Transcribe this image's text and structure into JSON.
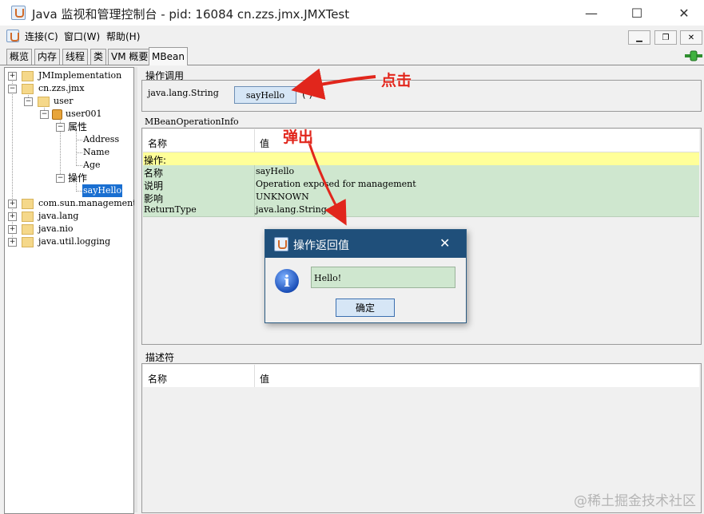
{
  "window": {
    "title": "Java 监视和管理控制台 - pid: 16084 cn.zzs.jmx.JMXTest",
    "minimize": "—",
    "maximize": "☐",
    "close": "✕"
  },
  "menu": [
    "连接(C)",
    "窗口(W)",
    "帮助(H)"
  ],
  "tabs": [
    "概览",
    "内存",
    "线程",
    "类",
    "VM 概要",
    "MBean"
  ],
  "tree": {
    "nodes": [
      "JMImplementation",
      "cn.zzs.jmx",
      "user",
      "user001",
      "属性",
      "Address",
      "Name",
      "Age",
      "操作",
      "sayHello",
      "com.sun.management",
      "java.lang",
      "java.nio",
      "java.util.logging"
    ]
  },
  "invoke": {
    "group_title": "操作调用",
    "return_type": "java.lang.String",
    "button_label": "sayHello",
    "parens": "( )"
  },
  "op_info": {
    "group_title": "MBeanOperationInfo",
    "header": {
      "name": "名称",
      "value": "值"
    },
    "section_row": "操作:",
    "rows": [
      {
        "name": "名称",
        "value": "sayHello"
      },
      {
        "name": "说明",
        "value": "Operation exposed for management"
      },
      {
        "name": "影响",
        "value": "UNKNOWN"
      },
      {
        "name": "ReturnType",
        "value": "java.lang.String"
      }
    ]
  },
  "descriptor": {
    "group_title": "描述符",
    "header": {
      "name": "名称",
      "value": "值"
    }
  },
  "dialog": {
    "title": "操作返回值",
    "close": "✕",
    "message": "Hello!",
    "ok_label": "确定"
  },
  "annotations": {
    "click": "点击",
    "popup": "弹出"
  },
  "watermark": "@稀土掘金技术社区",
  "colors": {
    "selection": "#1a6fd1",
    "section_row": "#ffff99",
    "info_rows": "#cfe7cf",
    "dialog_title": "#1f4f7a",
    "annotation": "#e1261c"
  }
}
